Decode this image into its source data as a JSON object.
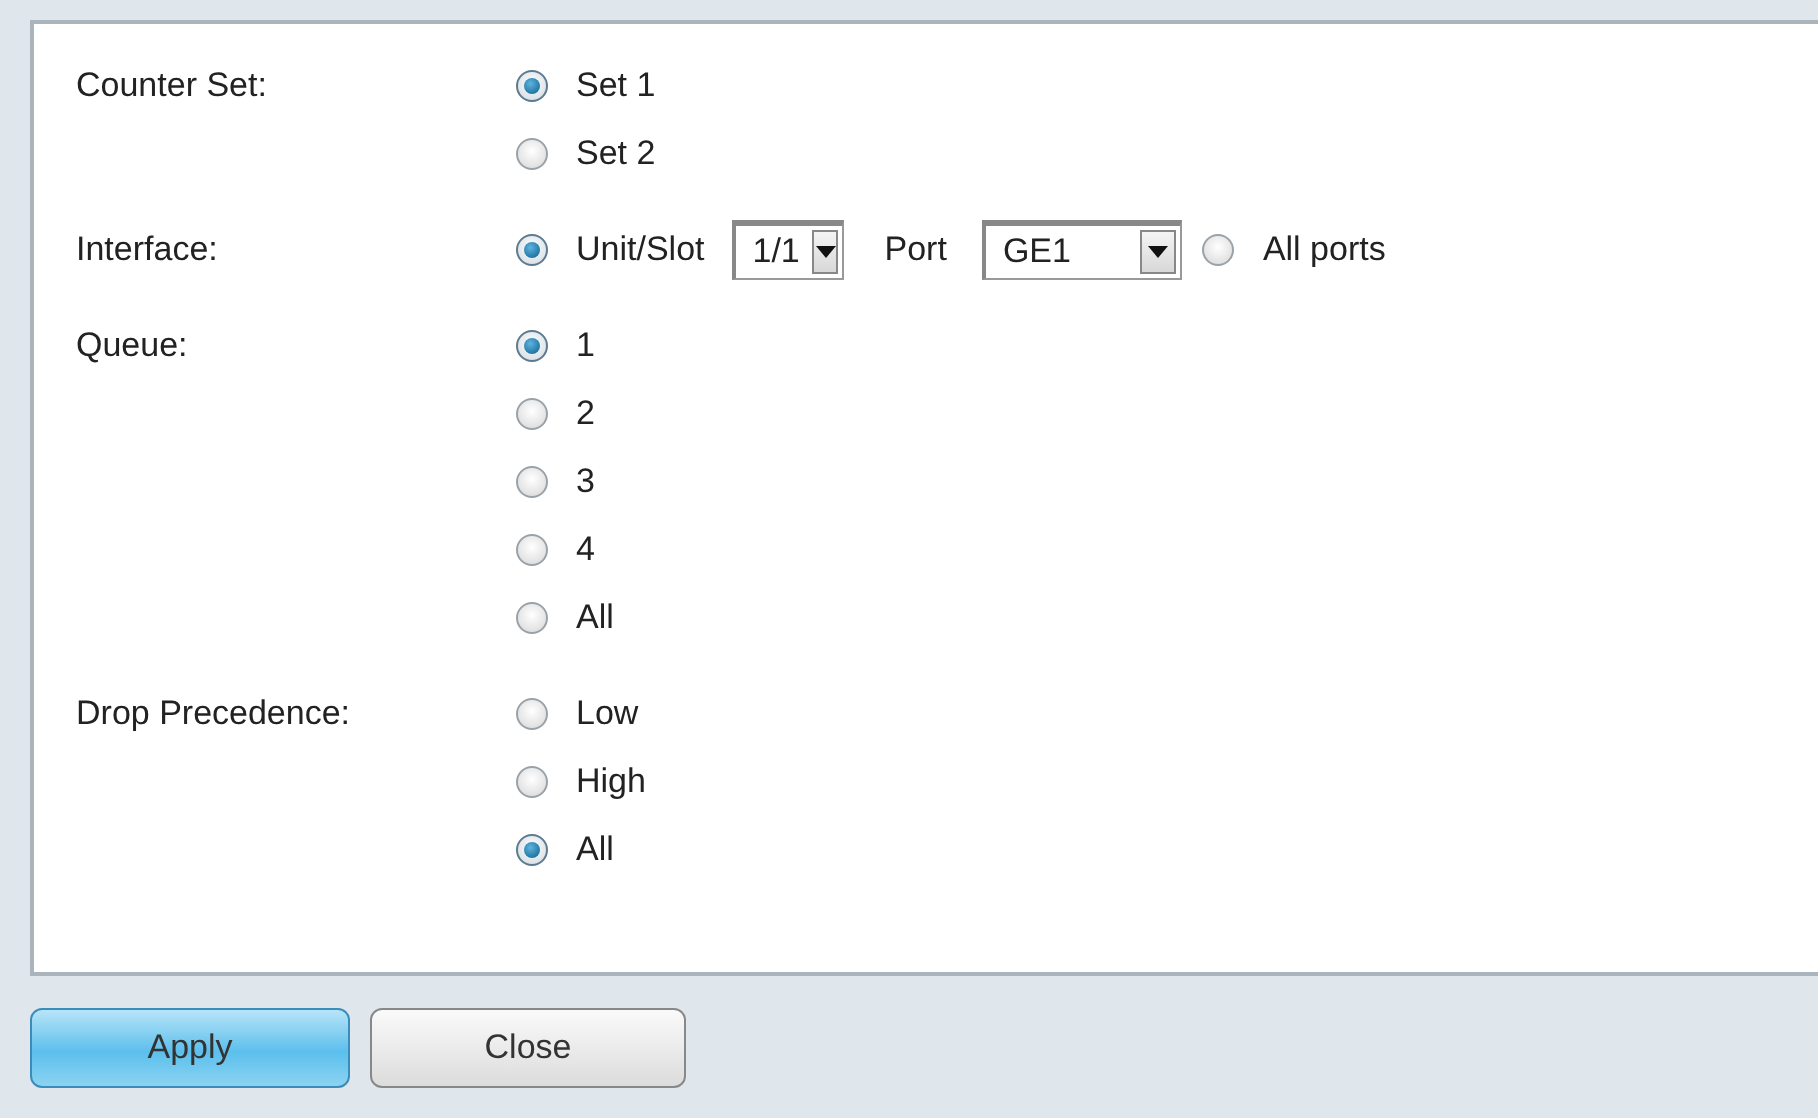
{
  "groups": [
    {
      "label": "Counter Set:",
      "kind": "stacked",
      "options": [
        {
          "kind": "radio",
          "label": "Set 1",
          "selected": true
        },
        {
          "kind": "radio",
          "label": "Set 2",
          "selected": false
        }
      ]
    },
    {
      "label": "Interface:",
      "kind": "inline",
      "options": [
        {
          "kind": "unit_slot",
          "label": "Unit/Slot",
          "selected": true,
          "slot_value": "1/1",
          "port_label": "Port",
          "port_value": "GE1"
        },
        {
          "kind": "radio",
          "label": "All ports",
          "selected": false
        }
      ]
    },
    {
      "label": "Queue:",
      "kind": "stacked",
      "options": [
        {
          "kind": "radio",
          "label": "1",
          "selected": true
        },
        {
          "kind": "radio",
          "label": "2",
          "selected": false
        },
        {
          "kind": "radio",
          "label": "3",
          "selected": false
        },
        {
          "kind": "radio",
          "label": "4",
          "selected": false
        },
        {
          "kind": "radio",
          "label": "All",
          "selected": false
        }
      ]
    },
    {
      "label": "Drop Precedence:",
      "kind": "stacked",
      "options": [
        {
          "kind": "radio",
          "label": "Low",
          "selected": false
        },
        {
          "kind": "radio",
          "label": "High",
          "selected": false
        },
        {
          "kind": "radio",
          "label": "All",
          "selected": true
        }
      ]
    }
  ],
  "buttons": [
    {
      "label": "Apply",
      "kind": "primary"
    },
    {
      "label": "Close",
      "kind": "secondary"
    }
  ]
}
